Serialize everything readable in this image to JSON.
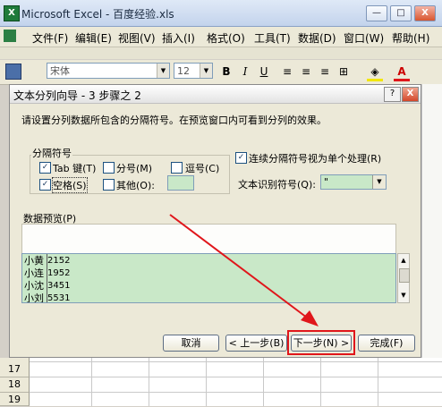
{
  "window": {
    "title": "Microsoft Excel - 百度经验.xls",
    "min": "—",
    "restore": "□",
    "close": "X",
    "app_icon": "X"
  },
  "menu": [
    "文件(F)",
    "编辑(E)",
    "视图(V)",
    "插入(I)",
    "格式(O)",
    "工具(T)",
    "数据(D)",
    "窗口(W)",
    "帮助(H)"
  ],
  "toolbar": {
    "font": "宋体",
    "size": "12",
    "bold": "B",
    "italic": "I",
    "underline": "U"
  },
  "dialog": {
    "title": "文本分列向导 - 3 步骤之 2",
    "help": "?",
    "close": "X",
    "instruction": "请设置分列数据所包含的分隔符号。在预览窗口内可看到分列的效果。",
    "delimiters_label": "分隔符号",
    "tab": {
      "label": "Tab 键(T)",
      "checked": true
    },
    "semicolon": {
      "label": "分号(M)",
      "checked": false
    },
    "comma": {
      "label": "逗号(C)",
      "checked": false
    },
    "space": {
      "label": "空格(S)",
      "checked": true
    },
    "other": {
      "label": "其他(O):",
      "checked": false,
      "value": ""
    },
    "consecutive": {
      "label": "连续分隔符号视为单个处理(R)",
      "checked": true
    },
    "qualifier_label": "文本识别符号(Q):",
    "qualifier_value": "\"",
    "preview_label": "数据预览(P)",
    "preview_rows": [
      {
        "name": "小黄",
        "value": "2152"
      },
      {
        "name": "小连",
        "value": "1952"
      },
      {
        "name": "小沈",
        "value": "3451"
      },
      {
        "name": "小刘",
        "value": "5531"
      }
    ],
    "buttons": {
      "cancel": "取消",
      "back": "< 上一步(B)",
      "next": "下一步(N) >",
      "finish": "完成(F)"
    }
  },
  "sheet": {
    "rows": [
      "17",
      "18",
      "19"
    ]
  },
  "colors": {
    "highlight": "#e0161b",
    "preview_bg": "#c9e8c8"
  }
}
